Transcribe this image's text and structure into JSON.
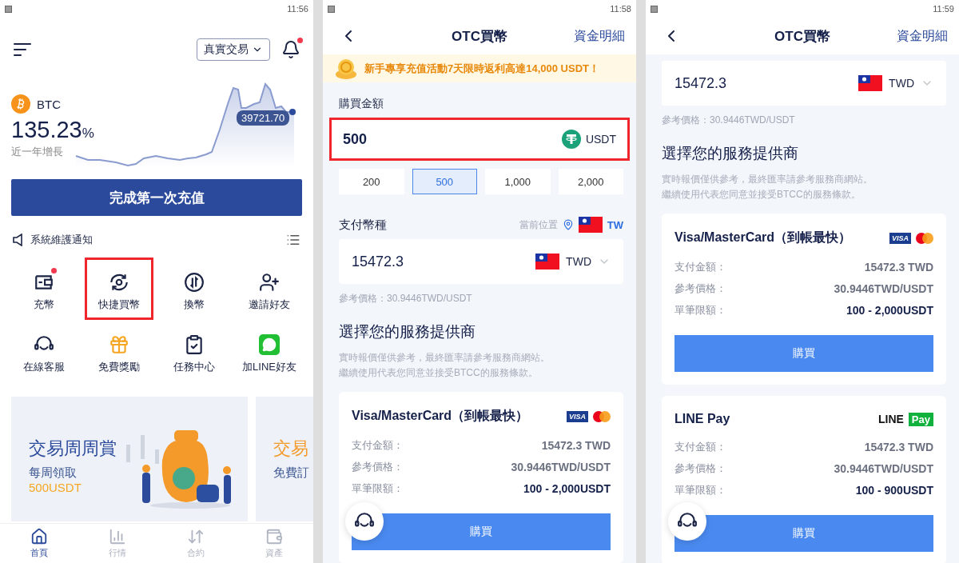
{
  "screens": [
    {
      "kind": "home",
      "status_time": "11:56",
      "mode_selector": "真實交易",
      "unread": true,
      "coin": {
        "symbol": "BTC",
        "change": "135.23",
        "unit": "%",
        "caption": "近一年增長",
        "tooltip": "39721.70"
      },
      "deposit_button": "完成第一次充值",
      "notice": "系統維護通知",
      "shortcuts": [
        {
          "label": "充幣",
          "badge": true,
          "highlighted": false
        },
        {
          "label": "快捷買幣",
          "badge": false,
          "highlighted": true
        },
        {
          "label": "換幣",
          "badge": false,
          "highlighted": false
        },
        {
          "label": "邀請好友",
          "badge": false,
          "highlighted": false
        },
        {
          "label": "在線客服",
          "badge": false,
          "highlighted": false
        },
        {
          "label": "免費獎勵",
          "badge": false,
          "highlighted": false
        },
        {
          "label": "任務中心",
          "badge": false,
          "highlighted": false
        },
        {
          "label": "加LINE好友",
          "badge": false,
          "highlighted": false
        }
      ],
      "banners": [
        {
          "kind": "full",
          "title": "交易周周賞",
          "subtitle": "每周領取",
          "amount": "500USDT"
        },
        {
          "kind": "partial",
          "title": "交易",
          "subtitle": "免費訂"
        }
      ],
      "nav": [
        {
          "label": "首頁",
          "selected": true
        },
        {
          "label": "行情",
          "selected": false
        },
        {
          "label": "合約",
          "selected": false
        },
        {
          "label": "資產",
          "selected": false
        }
      ]
    },
    {
      "kind": "otc",
      "status_time": "11:58",
      "title": "OTC買幣",
      "link": "資金明細",
      "promo": "新手專享充值活動7天限時返利高達14,000 USDT！",
      "amount_label": "購買金額",
      "amount": {
        "value": "500",
        "currency": "USDT",
        "highlighted": true
      },
      "presets": [
        {
          "label": "200",
          "selected": false
        },
        {
          "label": "500",
          "selected": true
        },
        {
          "label": "1,000",
          "selected": false
        },
        {
          "label": "2,000",
          "selected": false
        }
      ],
      "pay_label": "支付幣種",
      "location_label": "當前位置",
      "location": "TW",
      "pay_field": {
        "value": "15472.3",
        "currency": "TWD"
      },
      "reference": "參考價格：30.9446TWD/USDT",
      "providers_title": "選擇您的服務提供商",
      "disclaimer": [
        "實時報價僅供參考，最終匯率請參考服務商網站。",
        "繼續使用代表您同意並接受BTCC的服務條款。"
      ],
      "providers": [
        {
          "kind": "card",
          "name": "Visa/MasterCard（到帳最快）",
          "logo": [
            "VISA"
          ],
          "rows": [
            {
              "label": "支付金額：",
              "value": "15472.3 TWD",
              "emphasis": false
            },
            {
              "label": "參考價格：",
              "value": "30.9446TWD/USDT",
              "emphasis": false
            },
            {
              "label": "單筆限額：",
              "value": "100 - 2,000USDT",
              "emphasis": true
            }
          ],
          "button": "購買"
        }
      ]
    },
    {
      "kind": "otc",
      "status_time": "11:59",
      "title": "OTC買幣",
      "link": "資金明細",
      "pay_field": {
        "value": "15472.3",
        "currency": "TWD"
      },
      "reference": "參考價格：30.9446TWD/USDT",
      "providers_title": "選擇您的服務提供商",
      "disclaimer": [
        "實時報價僅供參考，最終匯率請參考服務商網站。",
        "繼續使用代表您同意並接受BTCC的服務條款。"
      ],
      "providers": [
        {
          "kind": "card",
          "name": "Visa/MasterCard（到帳最快）",
          "logo": [
            "VISA"
          ],
          "rows": [
            {
              "label": "支付金額：",
              "value": "15472.3 TWD",
              "emphasis": false
            },
            {
              "label": "參考價格：",
              "value": "30.9446TWD/USDT",
              "emphasis": false
            },
            {
              "label": "單筆限額：",
              "value": "100 - 2,000USDT",
              "emphasis": true
            }
          ],
          "button": "購買"
        },
        {
          "kind": "linepay",
          "name": "LINE Pay",
          "logo": [
            "LINE",
            "Pay"
          ],
          "rows": [
            {
              "label": "支付金額：",
              "value": "15472.3 TWD",
              "emphasis": false
            },
            {
              "label": "參考價格：",
              "value": "30.9446TWD/USDT",
              "emphasis": false
            },
            {
              "label": "單筆限額：",
              "value": "100 - 900USDT",
              "emphasis": true
            }
          ],
          "button": "購買"
        }
      ]
    }
  ]
}
